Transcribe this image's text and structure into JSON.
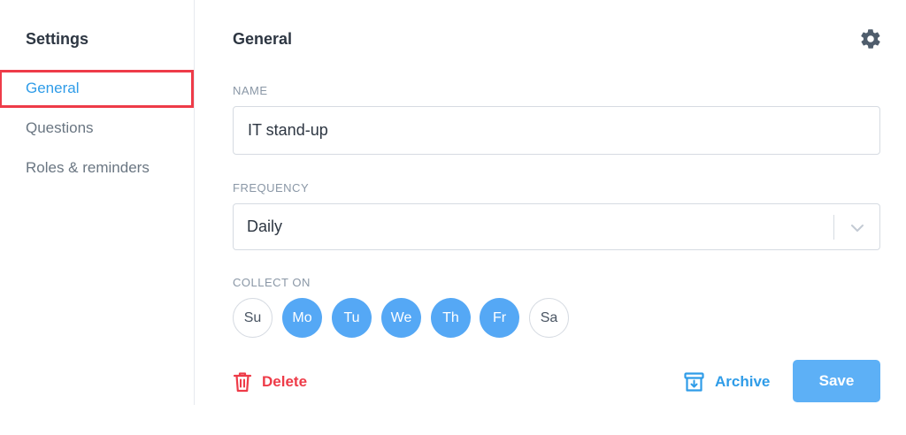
{
  "sidebar": {
    "title": "Settings",
    "items": [
      {
        "label": "General",
        "active": true
      },
      {
        "label": "Questions",
        "active": false
      },
      {
        "label": "Roles & reminders",
        "active": false
      }
    ]
  },
  "main": {
    "title": "General",
    "settings_icon": "gear-icon",
    "name": {
      "label": "NAME",
      "value": "IT stand-up"
    },
    "frequency": {
      "label": "FREQUENCY",
      "selected": "Daily"
    },
    "collect_on": {
      "label": "COLLECT ON",
      "days": [
        {
          "label": "Su",
          "selected": false
        },
        {
          "label": "Mo",
          "selected": true
        },
        {
          "label": "Tu",
          "selected": true
        },
        {
          "label": "We",
          "selected": true
        },
        {
          "label": "Th",
          "selected": true
        },
        {
          "label": "Fr",
          "selected": true
        },
        {
          "label": "Sa",
          "selected": false
        }
      ]
    },
    "actions": {
      "delete_label": "Delete",
      "archive_label": "Archive",
      "save_label": "Save"
    }
  },
  "colors": {
    "accent": "#2f9ce8",
    "danger": "#ee3b48",
    "day_selected": "#55a8f5",
    "save_button": "#5db0f6",
    "highlight_border": "#ee3b48"
  }
}
